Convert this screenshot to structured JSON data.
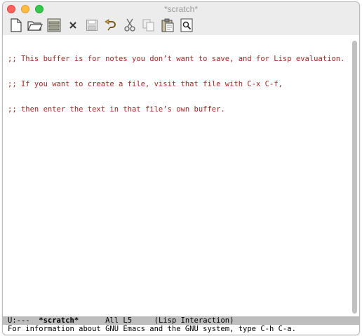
{
  "window": {
    "title": "*scratch*"
  },
  "toolbar": {
    "icons": [
      "new-file-icon",
      "open-folder-icon",
      "dired-icon",
      "close-icon",
      "save-icon",
      "undo-icon",
      "cut-icon",
      "copy-icon",
      "paste-icon",
      "search-icon"
    ]
  },
  "buffer": {
    "lines": [
      ";; This buffer is for notes you don’t want to save, and for Lisp evaluation.",
      ";; If you want to create a file, visit that file with C-x C-f,",
      ";; then enter the text in that file’s own buffer."
    ],
    "text_color": "#b22222"
  },
  "modeline": {
    "status": "U:---",
    "buffer_name": "*scratch*",
    "position": "All L5",
    "mode": "(Lisp Interaction)"
  },
  "echo_area": "For information about GNU Emacs and the GNU system, type C-h C-a."
}
